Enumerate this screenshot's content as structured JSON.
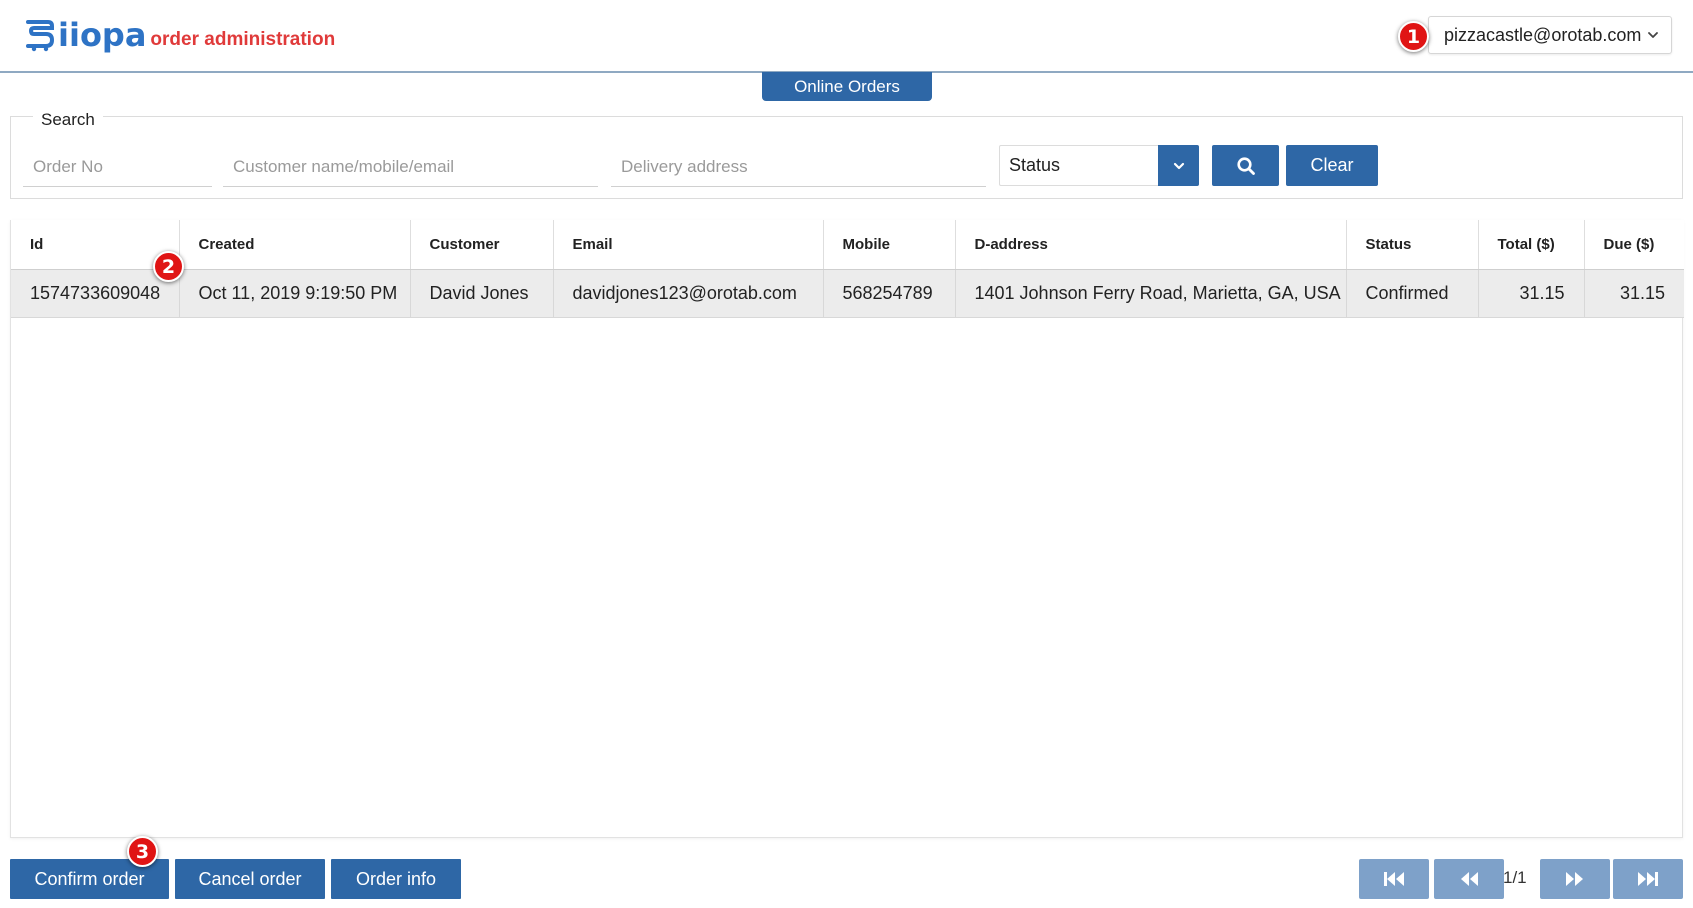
{
  "app": {
    "logo_text": "iiopa",
    "subtitle": "order administration",
    "user_email": "pizzacastle@orotab.com",
    "active_tab": "Online Orders"
  },
  "search": {
    "legend": "Search",
    "order_no_placeholder": "Order No",
    "customer_placeholder": "Customer name/mobile/email",
    "address_placeholder": "Delivery address",
    "status_label": "Status",
    "clear_label": "Clear"
  },
  "table": {
    "columns": [
      "Id",
      "Created",
      "Customer",
      "Email",
      "Mobile",
      "D-address",
      "Status",
      "Total ($)",
      "Due ($)"
    ],
    "rows": [
      [
        "1574733609048",
        "Oct 11, 2019 9:19:50 PM",
        "David Jones",
        "davidjones123@orotab.com",
        "568254789",
        "1401 Johnson Ferry Road, Marietta, GA, USA",
        "Confirmed",
        "31.15",
        "31.15"
      ]
    ]
  },
  "actions": {
    "confirm_label": "Confirm order",
    "cancel_label": "Cancel order",
    "info_label": "Order info"
  },
  "pagination": {
    "indicator": "1/1"
  },
  "markers": [
    "1",
    "2",
    "3"
  ],
  "icons": {
    "user_dropdown": "chevron-down-icon",
    "status_dropdown": "chevron-down-icon",
    "search": "search-icon",
    "first_page": "first-page-icon",
    "prev_page": "prev-page-icon",
    "next_page": "next-page-icon",
    "last_page": "last-page-icon"
  },
  "colors": {
    "primary": "#2e67a6",
    "pager": "#7ea1c9",
    "logo_blue": "#2e73c5",
    "subtitle_red": "#e03a3a",
    "marker_red": "#e01414",
    "selected_row": "#ececec"
  }
}
